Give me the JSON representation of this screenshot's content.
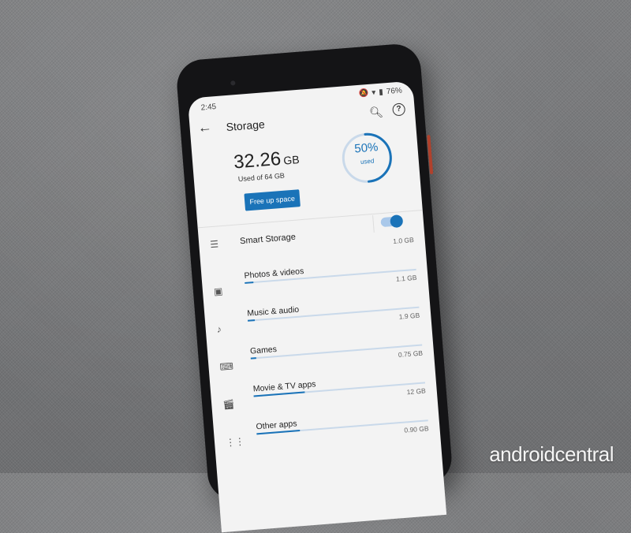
{
  "status": {
    "time": "2:45",
    "battery": "76%"
  },
  "appbar": {
    "title": "Storage",
    "icons": [
      "back-icon",
      "search-icon",
      "help-icon"
    ]
  },
  "summary": {
    "used_amount": "32.26",
    "used_unit": "GB",
    "used_caption": "Used of 64 GB",
    "percent": "50%",
    "percent_label": "used",
    "percent_value": 50
  },
  "actions": {
    "free_up": "Free up space"
  },
  "smart_storage": {
    "label": "Smart Storage",
    "enabled": true
  },
  "categories": [
    {
      "name": "",
      "size": "1.0 GB",
      "fill": 0.05
    },
    {
      "name": "Photos & videos",
      "size": "1.1 GB",
      "fill": 0.05
    },
    {
      "name": "Music & audio",
      "size": "1.9 GB",
      "fill": 0.04
    },
    {
      "name": "Games",
      "size": "0.75 GB",
      "fill": 0.03
    },
    {
      "name": "Movie & TV apps",
      "size": "12 GB",
      "fill": 0.3
    },
    {
      "name": "Other apps",
      "size": "0.90 GB",
      "fill": 0.25
    }
  ],
  "colors": {
    "accent": "#1a73b8",
    "track": "#c9d9ea"
  },
  "watermark": "androidcentral"
}
